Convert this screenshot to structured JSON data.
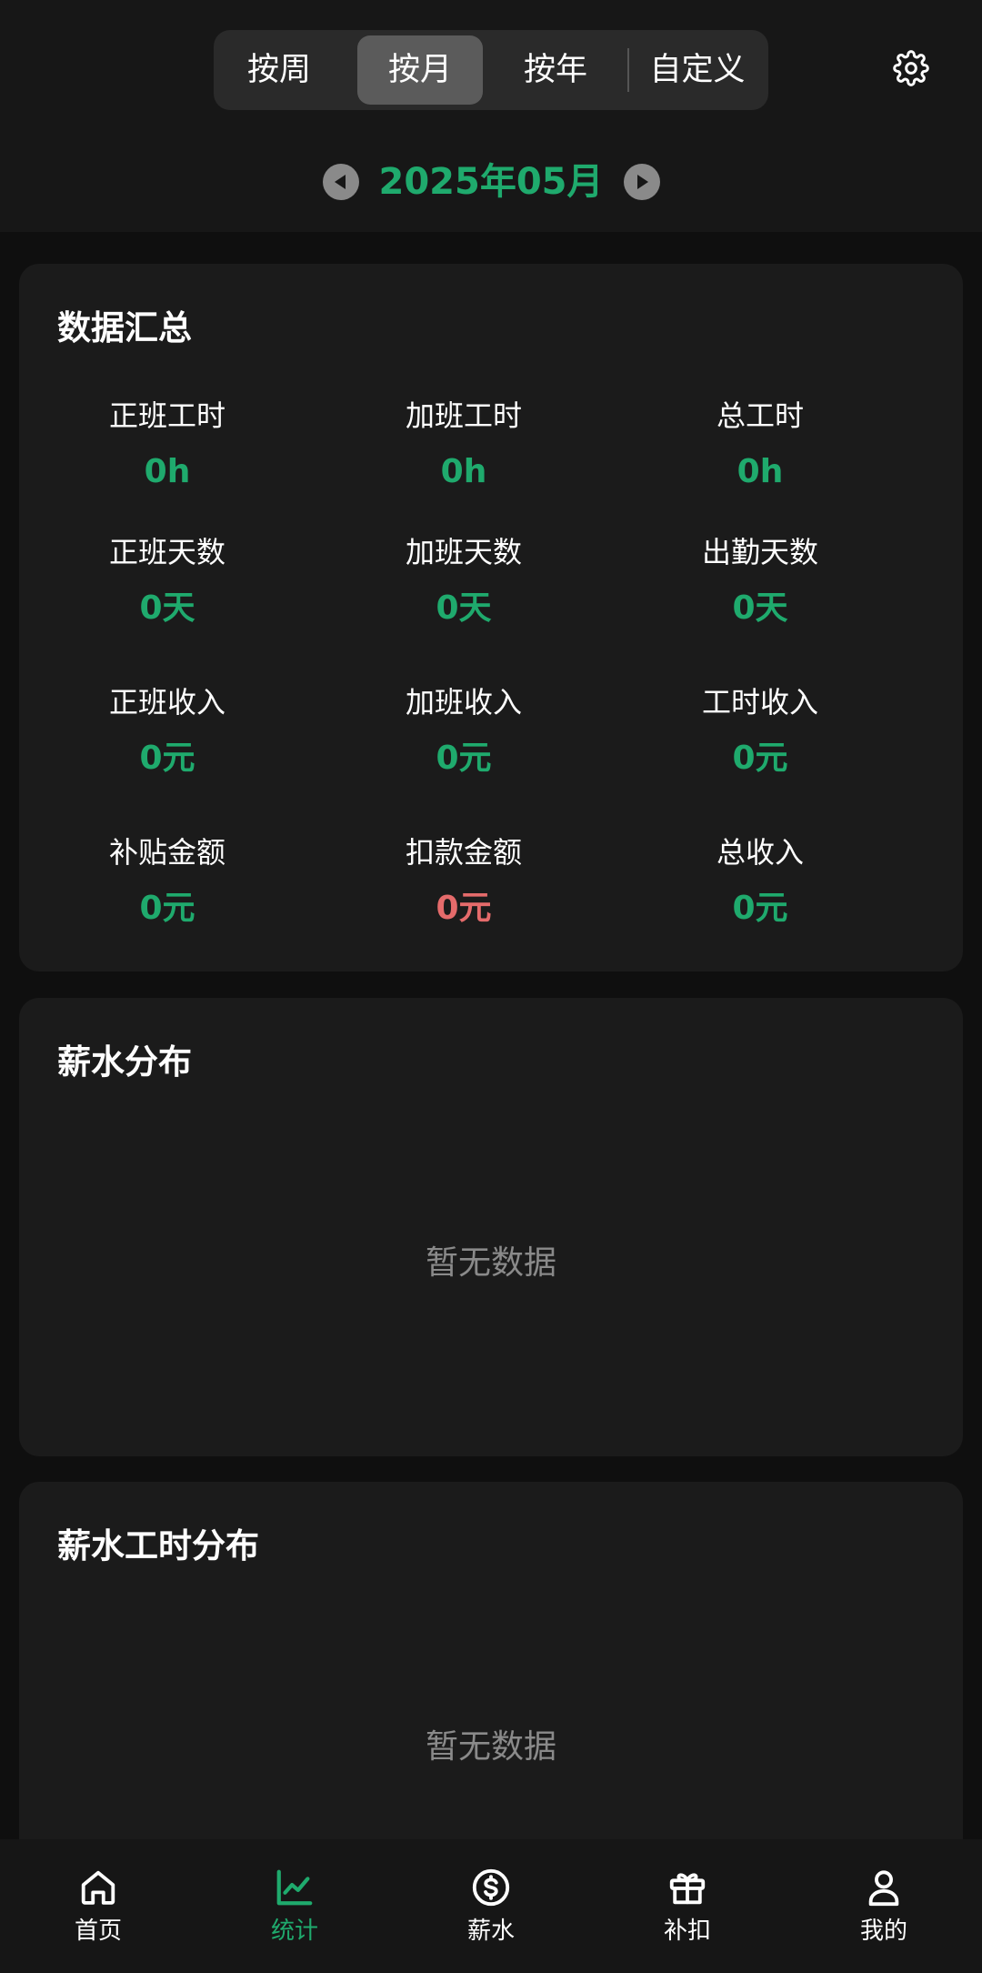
{
  "header": {
    "segments": [
      {
        "label": "按周",
        "active": false
      },
      {
        "label": "按月",
        "active": true
      },
      {
        "label": "按年",
        "active": false
      },
      {
        "label": "自定义",
        "active": false
      }
    ],
    "settings_icon": "gear-icon",
    "date": "2025年05月",
    "prev_icon": "triangle-left-icon",
    "next_icon": "triangle-right-icon"
  },
  "summary": {
    "title": "数据汇总",
    "items": [
      {
        "label": "正班工时",
        "value": "0h"
      },
      {
        "label": "加班工时",
        "value": "0h"
      },
      {
        "label": "总工时",
        "value": "0h"
      },
      {
        "label": "正班天数",
        "value": "0天"
      },
      {
        "label": "加班天数",
        "value": "0天"
      },
      {
        "label": "出勤天数",
        "value": "0天"
      },
      {
        "label": "正班收入",
        "value": "0元"
      },
      {
        "label": "加班收入",
        "value": "0元"
      },
      {
        "label": "工时收入",
        "value": "0元"
      },
      {
        "label": "补贴金额",
        "value": "0元"
      },
      {
        "label": "扣款金额",
        "value": "0元"
      },
      {
        "label": "总收入",
        "value": "0元"
      }
    ]
  },
  "salary_dist": {
    "title": "薪水分布",
    "empty": "暂无数据"
  },
  "salary_hours_dist": {
    "title": "薪水工时分布",
    "empty": "暂无数据"
  },
  "tabbar": {
    "items": [
      {
        "label": "首页",
        "icon": "home-icon"
      },
      {
        "label": "统计",
        "icon": "chart-icon"
      },
      {
        "label": "薪水",
        "icon": "dollar-icon"
      },
      {
        "label": "补扣",
        "icon": "gift-icon"
      },
      {
        "label": "我的",
        "icon": "user-icon"
      }
    ]
  },
  "colors": {
    "accent": "#1faa6d",
    "negative": "#e56b6b",
    "background": "#0f0f0f",
    "card": "#1b1b1b"
  }
}
